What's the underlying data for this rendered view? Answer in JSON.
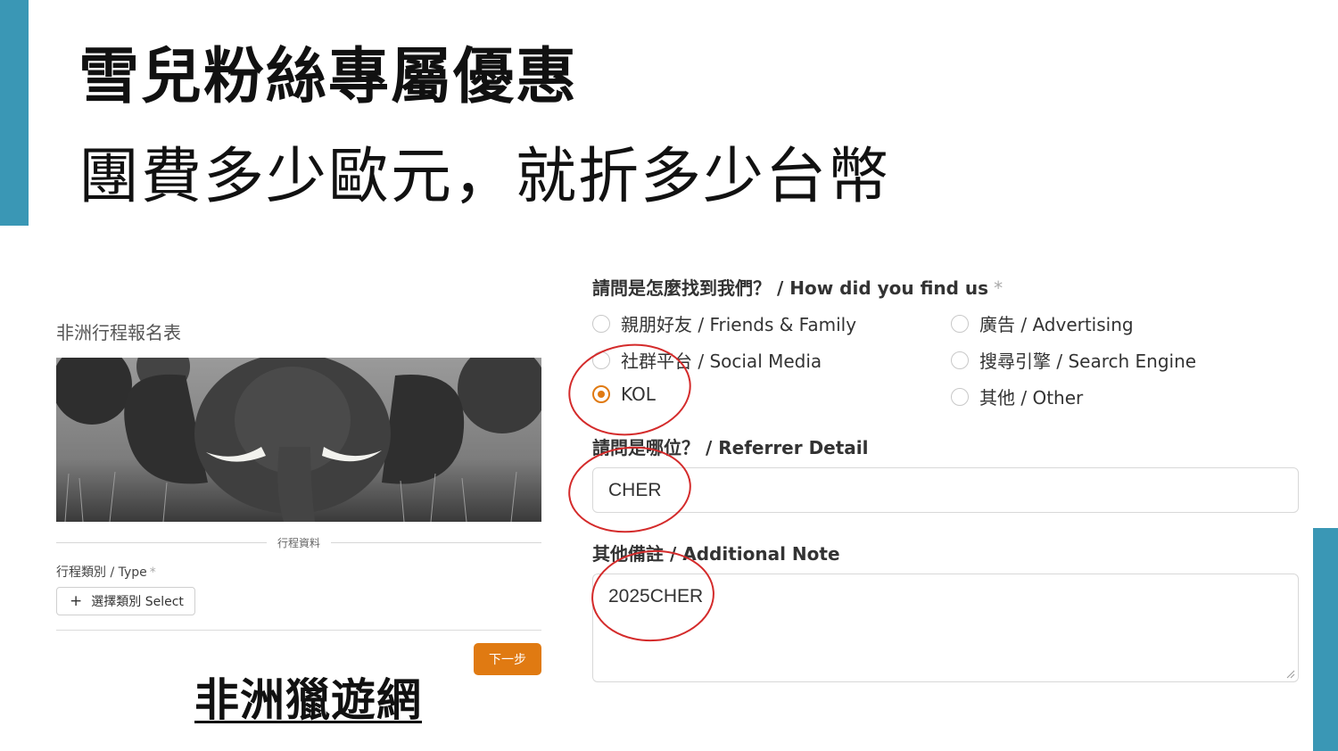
{
  "slide": {
    "title": "雪兒粉絲專屬優惠",
    "subtitle": "團費多少歐元，就折多少台幣",
    "brand": "非洲獵遊網",
    "accent_color": "#3a97b5"
  },
  "left_form": {
    "title": "非洲行程報名表",
    "hero_image": "elephant-photo",
    "section_label": "行程資料",
    "type_label": "行程類別 / Type",
    "required_mark": "*",
    "select_label": "選擇類別 Select",
    "select_icon": "plus-icon",
    "next_label": "下一步",
    "button_color": "#e07a12"
  },
  "right_form": {
    "question_label": "請問是怎麼找到我們？ / How did you find us",
    "required_mark": "*",
    "options": [
      {
        "label": "親朋好友 / Friends & Family",
        "checked": false
      },
      {
        "label": "廣告 / Advertising",
        "checked": false
      },
      {
        "label": "社群平台 / Social Media",
        "checked": false
      },
      {
        "label": "搜尋引擎 / Search Engine",
        "checked": false
      },
      {
        "label": "KOL",
        "checked": true
      },
      {
        "label": "其他 / Other",
        "checked": false
      }
    ],
    "referrer_label": "請問是哪位？ / Referrer Detail",
    "referrer_value": "CHER",
    "note_label": "其他備註 / Additional Note",
    "note_value": "2025CHER",
    "annotation_color": "#d42b2b"
  }
}
